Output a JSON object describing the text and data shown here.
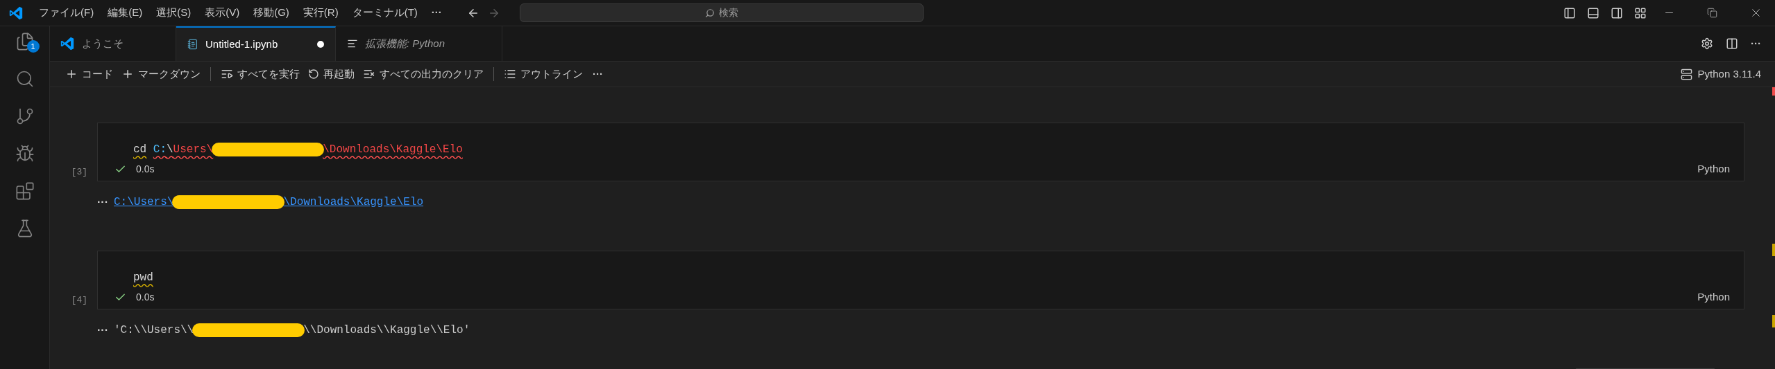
{
  "title_bar": {
    "menus": [
      "ファイル(F)",
      "編集(E)",
      "選択(S)",
      "表示(V)",
      "移動(G)",
      "実行(R)",
      "ターミナル(T)"
    ],
    "more": "···",
    "forward_disabled": true,
    "search": {
      "placeholder": "検索"
    }
  },
  "activity_bar": [
    {
      "kind": "explorer",
      "badge": "1"
    },
    {
      "kind": "search"
    },
    {
      "kind": "source-control"
    },
    {
      "kind": "run-debug"
    },
    {
      "kind": "extensions"
    },
    {
      "kind": "testing"
    }
  ],
  "tabs": [
    {
      "kind": "welcome",
      "label": "ようこそ",
      "selected": false,
      "modified": false,
      "preview": false
    },
    {
      "kind": "notebook",
      "label": "Untitled-1.ipynb",
      "selected": true,
      "modified": true,
      "preview": false
    },
    {
      "kind": "extension",
      "label": "拡張機能: Python",
      "selected": false,
      "modified": false,
      "preview": true
    }
  ],
  "editor_actions_more": "···",
  "toolbar": {
    "items": [
      {
        "kind": "add",
        "label": "コード"
      },
      {
        "kind": "add",
        "label": "マークダウン"
      },
      {
        "kind": "separator"
      },
      {
        "kind": "run-all",
        "label": "すべてを実行"
      },
      {
        "kind": "restart",
        "label": "再起動"
      },
      {
        "kind": "clear",
        "label": "すべての出力のクリア"
      },
      {
        "kind": "separator"
      },
      {
        "kind": "outline",
        "label": "アウトライン"
      },
      {
        "kind": "more",
        "label": "···"
      }
    ],
    "kernel": "Python 3.11.4"
  },
  "cells": [
    {
      "execution_count": "[3]",
      "success": true,
      "duration": "0.0s",
      "language": "Python",
      "code": [
        [
          {
            "kind": "warning",
            "text": "cd",
            "color": "#d4d4d4"
          }
        ],
        [
          {
            "kind": "error",
            "text": "C:",
            "color": "#4fc1ff"
          },
          {
            "kind": "error",
            "text": "\\",
            "color": "#d4d4d4"
          },
          {
            "kind": "error",
            "text": "Users\\",
            "color": "#f44747"
          },
          {
            "kind": "redaction"
          },
          {
            "kind": "error",
            "text": "\\Downloads\\Kaggle\\Elo",
            "color": "#f44747"
          }
        ]
      ],
      "output": {
        "more": "···",
        "kind": "link",
        "parts": [
          {
            "kind": "text",
            "text": "C:\\Users\\"
          },
          {
            "kind": "redaction"
          },
          {
            "kind": "text",
            "text": "\\Downloads\\Kaggle\\Elo"
          }
        ]
      }
    },
    {
      "execution_count": "[4]",
      "success": true,
      "duration": "0.0s",
      "language": "Python",
      "code": [
        [
          {
            "kind": "warning",
            "text": "pwd",
            "color": "#d4d4d4"
          }
        ]
      ],
      "output": {
        "more": "···",
        "kind": "text",
        "parts": [
          {
            "kind": "text",
            "text": "'C:\\\\Users\\\\"
          },
          {
            "kind": "redaction"
          },
          {
            "kind": "text",
            "text": "\\\\Downloads\\\\Kaggle\\\\Elo'"
          }
        ]
      }
    }
  ]
}
